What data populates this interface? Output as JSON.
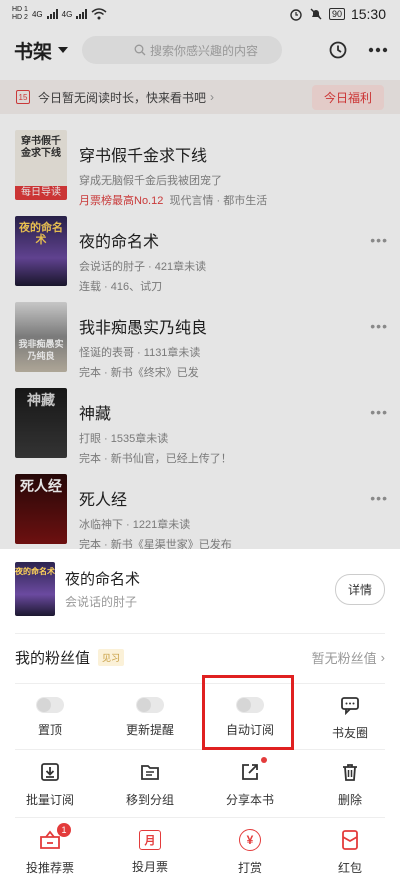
{
  "status_bar": {
    "sim1": "HD 1",
    "sim2": "HD 2",
    "net1": "4G",
    "net2": "4G",
    "battery": "90",
    "time": "15:30"
  },
  "header": {
    "title": "书架",
    "search_placeholder": "搜索你感兴趣的内容"
  },
  "notice": {
    "calendar_day": "15",
    "text": "今日暂无阅读时长，快来看书吧",
    "welfare_button": "今日福利"
  },
  "books": [
    {
      "title": "穿书假千金求下线",
      "cover_text": "穿书假千金求下线",
      "badge": "每日导读",
      "line1": "穿成无脑假千金后我被团宠了",
      "line2_hot": "月票榜最高No.12",
      "line2_rest": "现代言情 · 都市生活"
    },
    {
      "title": "夜的命名术",
      "cover_text": "夜的命名术",
      "line1": "会说话的肘子 · 421章未读",
      "line2": "连载 · 416、试刀"
    },
    {
      "title": "我非痴愚实乃纯良",
      "cover_text": "我非痴愚实乃纯良",
      "line1": "怪诞的表哥 · 1131章未读",
      "line2": "完本 · 新书《终宋》已发"
    },
    {
      "title": "神藏",
      "cover_text": "神藏",
      "line1": "打眼 · 1535章未读",
      "line2": "完本 · 新书仙官，已经上传了！"
    },
    {
      "title": "死人经",
      "cover_text": "死人经",
      "line1": "冰临神下 · 1221章未读",
      "line2": "完本 · 新书《星渠世家》已发布"
    }
  ],
  "sheet": {
    "book_title": "夜的命名术",
    "book_author": "会说话的肘子",
    "cover_text": "夜的命名术",
    "detail_button": "详情",
    "fan_label": "我的粉丝值",
    "fan_tag": "见习",
    "fan_value": "暂无粉丝值",
    "row1": [
      {
        "label": "置顶",
        "kind": "toggle"
      },
      {
        "label": "更新提醒",
        "kind": "toggle"
      },
      {
        "label": "自动订阅",
        "kind": "toggle"
      },
      {
        "label": "书友圈",
        "kind": "chat-icon"
      }
    ],
    "row2": [
      {
        "label": "批量订阅",
        "icon": "download-icon"
      },
      {
        "label": "移到分组",
        "icon": "folder-icon"
      },
      {
        "label": "分享本书",
        "icon": "share-icon"
      },
      {
        "label": "删除",
        "icon": "trash-icon"
      }
    ],
    "row3": [
      {
        "label": "投推荐票",
        "icon": "recommend-ticket-icon",
        "badge": "1"
      },
      {
        "label": "投月票",
        "icon": "month-ticket-icon",
        "icon_text": "月"
      },
      {
        "label": "打赏",
        "icon": "reward-icon",
        "icon_text": "¥"
      },
      {
        "label": "红包",
        "icon": "red-packet-icon"
      }
    ]
  },
  "colors": {
    "accent": "#e33b3b",
    "highlight": "#e02020"
  }
}
